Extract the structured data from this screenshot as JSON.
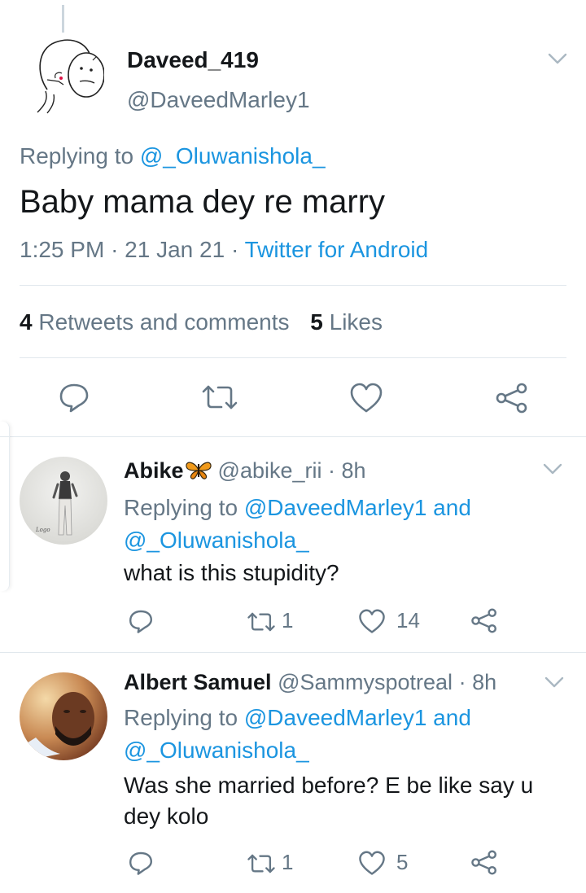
{
  "main_tweet": {
    "display_name": "Daveed_419",
    "handle": "@DaveedMarley1",
    "replying_prefix": "Replying to ",
    "replying_to": "@_Oluwanishola_",
    "text": "Baby mama dey re marry",
    "time": "1:25 PM",
    "date": "21 Jan 21",
    "source": "Twitter for Android",
    "sep": "·",
    "retweets_count": "4",
    "retweets_label": "Retweets and comments",
    "likes_count": "5",
    "likes_label": "Likes"
  },
  "replies": [
    {
      "display_name": "Abike",
      "handle": "@abike_rii",
      "age": "· 8h",
      "replying_prefix": "Replying to ",
      "replying_to_1": "@DaveedMarley1",
      "and": " and",
      "replying_to_2": "@_Oluwanishola_",
      "text": "what is this stupidity?",
      "retweets": "1",
      "likes": "14"
    },
    {
      "display_name": "Albert Samuel",
      "handle": "@Sammyspotreal",
      "age": "· 8h",
      "replying_prefix": "Replying to ",
      "replying_to_1": "@DaveedMarley1",
      "and": " and",
      "replying_to_2": "@_Oluwanishola_",
      "text": "Was she married before? E be like say u dey kolo",
      "retweets": "1",
      "likes": "5"
    }
  ],
  "colors": {
    "link": "#1b95e0",
    "muted": "#657786",
    "divider": "#e1e8ed"
  }
}
